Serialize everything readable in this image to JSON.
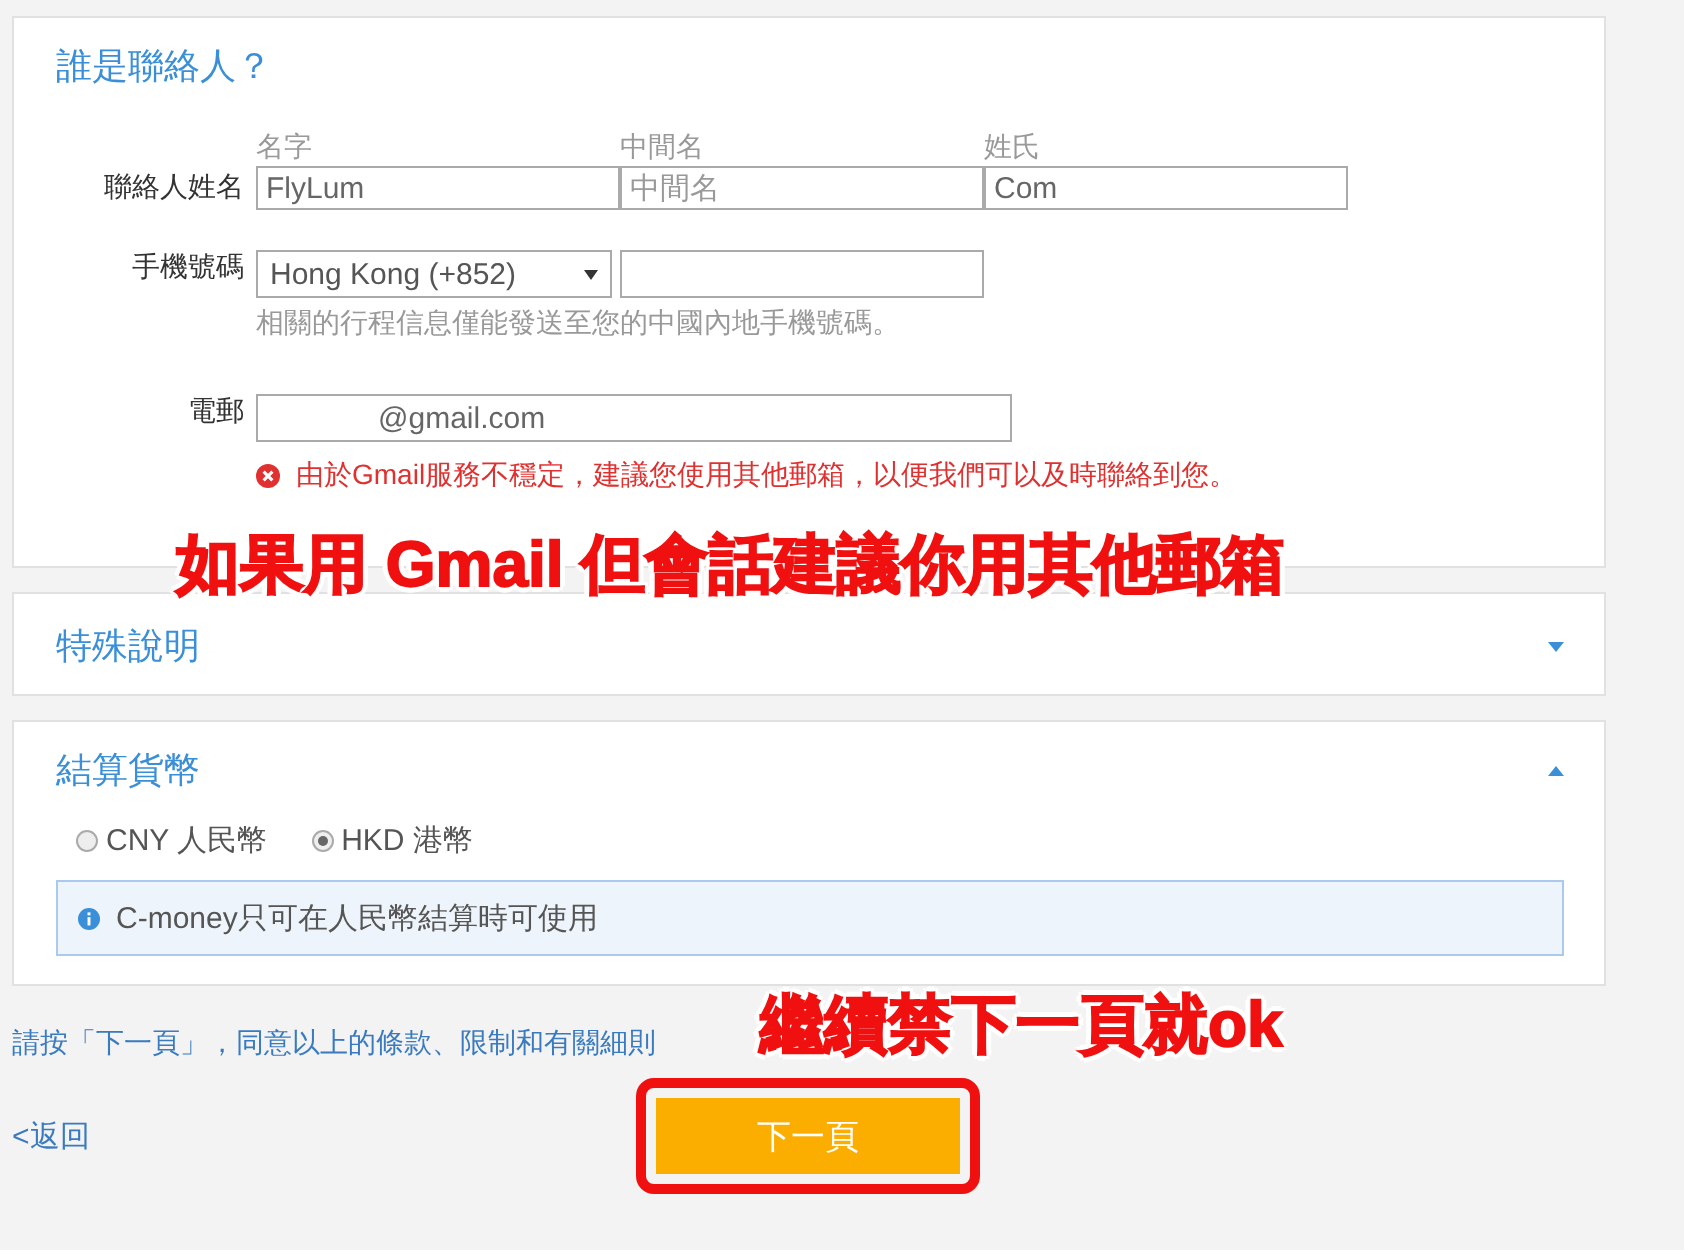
{
  "contact": {
    "title": "誰是聯絡人？",
    "name": {
      "label": "聯絡人姓名",
      "fields": [
        {
          "label": "名字",
          "value": "FlyLum"
        },
        {
          "label": "中間名",
          "placeholder": "中間名"
        },
        {
          "label": "姓氏",
          "value": "Com"
        }
      ]
    },
    "phone": {
      "label": "手機號碼",
      "country": "Hong Kong (+852)",
      "hint": "相關的行程信息僅能發送至您的中國內地手機號碼。"
    },
    "email": {
      "label": "電郵",
      "value": "@gmail.com",
      "error": "由於Gmail服務不穩定，建議您使用其他郵箱，以便我們可以及時聯絡到您。"
    }
  },
  "annotations": [
    {
      "text": "如果用 Gmail 但會話建議你用其他郵箱"
    },
    {
      "text": "繼續禁下一頁就ok"
    }
  ],
  "special": {
    "title": "特殊說明",
    "expanded": false
  },
  "currency": {
    "title": "結算貨幣",
    "expanded": true,
    "options": [
      {
        "label": "CNY 人民幣",
        "selected": false
      },
      {
        "label": "HKD 港幣",
        "selected": true
      }
    ],
    "info": "C-money只可在人民幣結算時可使用"
  },
  "terms": "請按「下一頁」，同意以上的條款、限制和有關細則",
  "back": "<返回",
  "next": {
    "label": "下一頁",
    "highlighted": true
  }
}
